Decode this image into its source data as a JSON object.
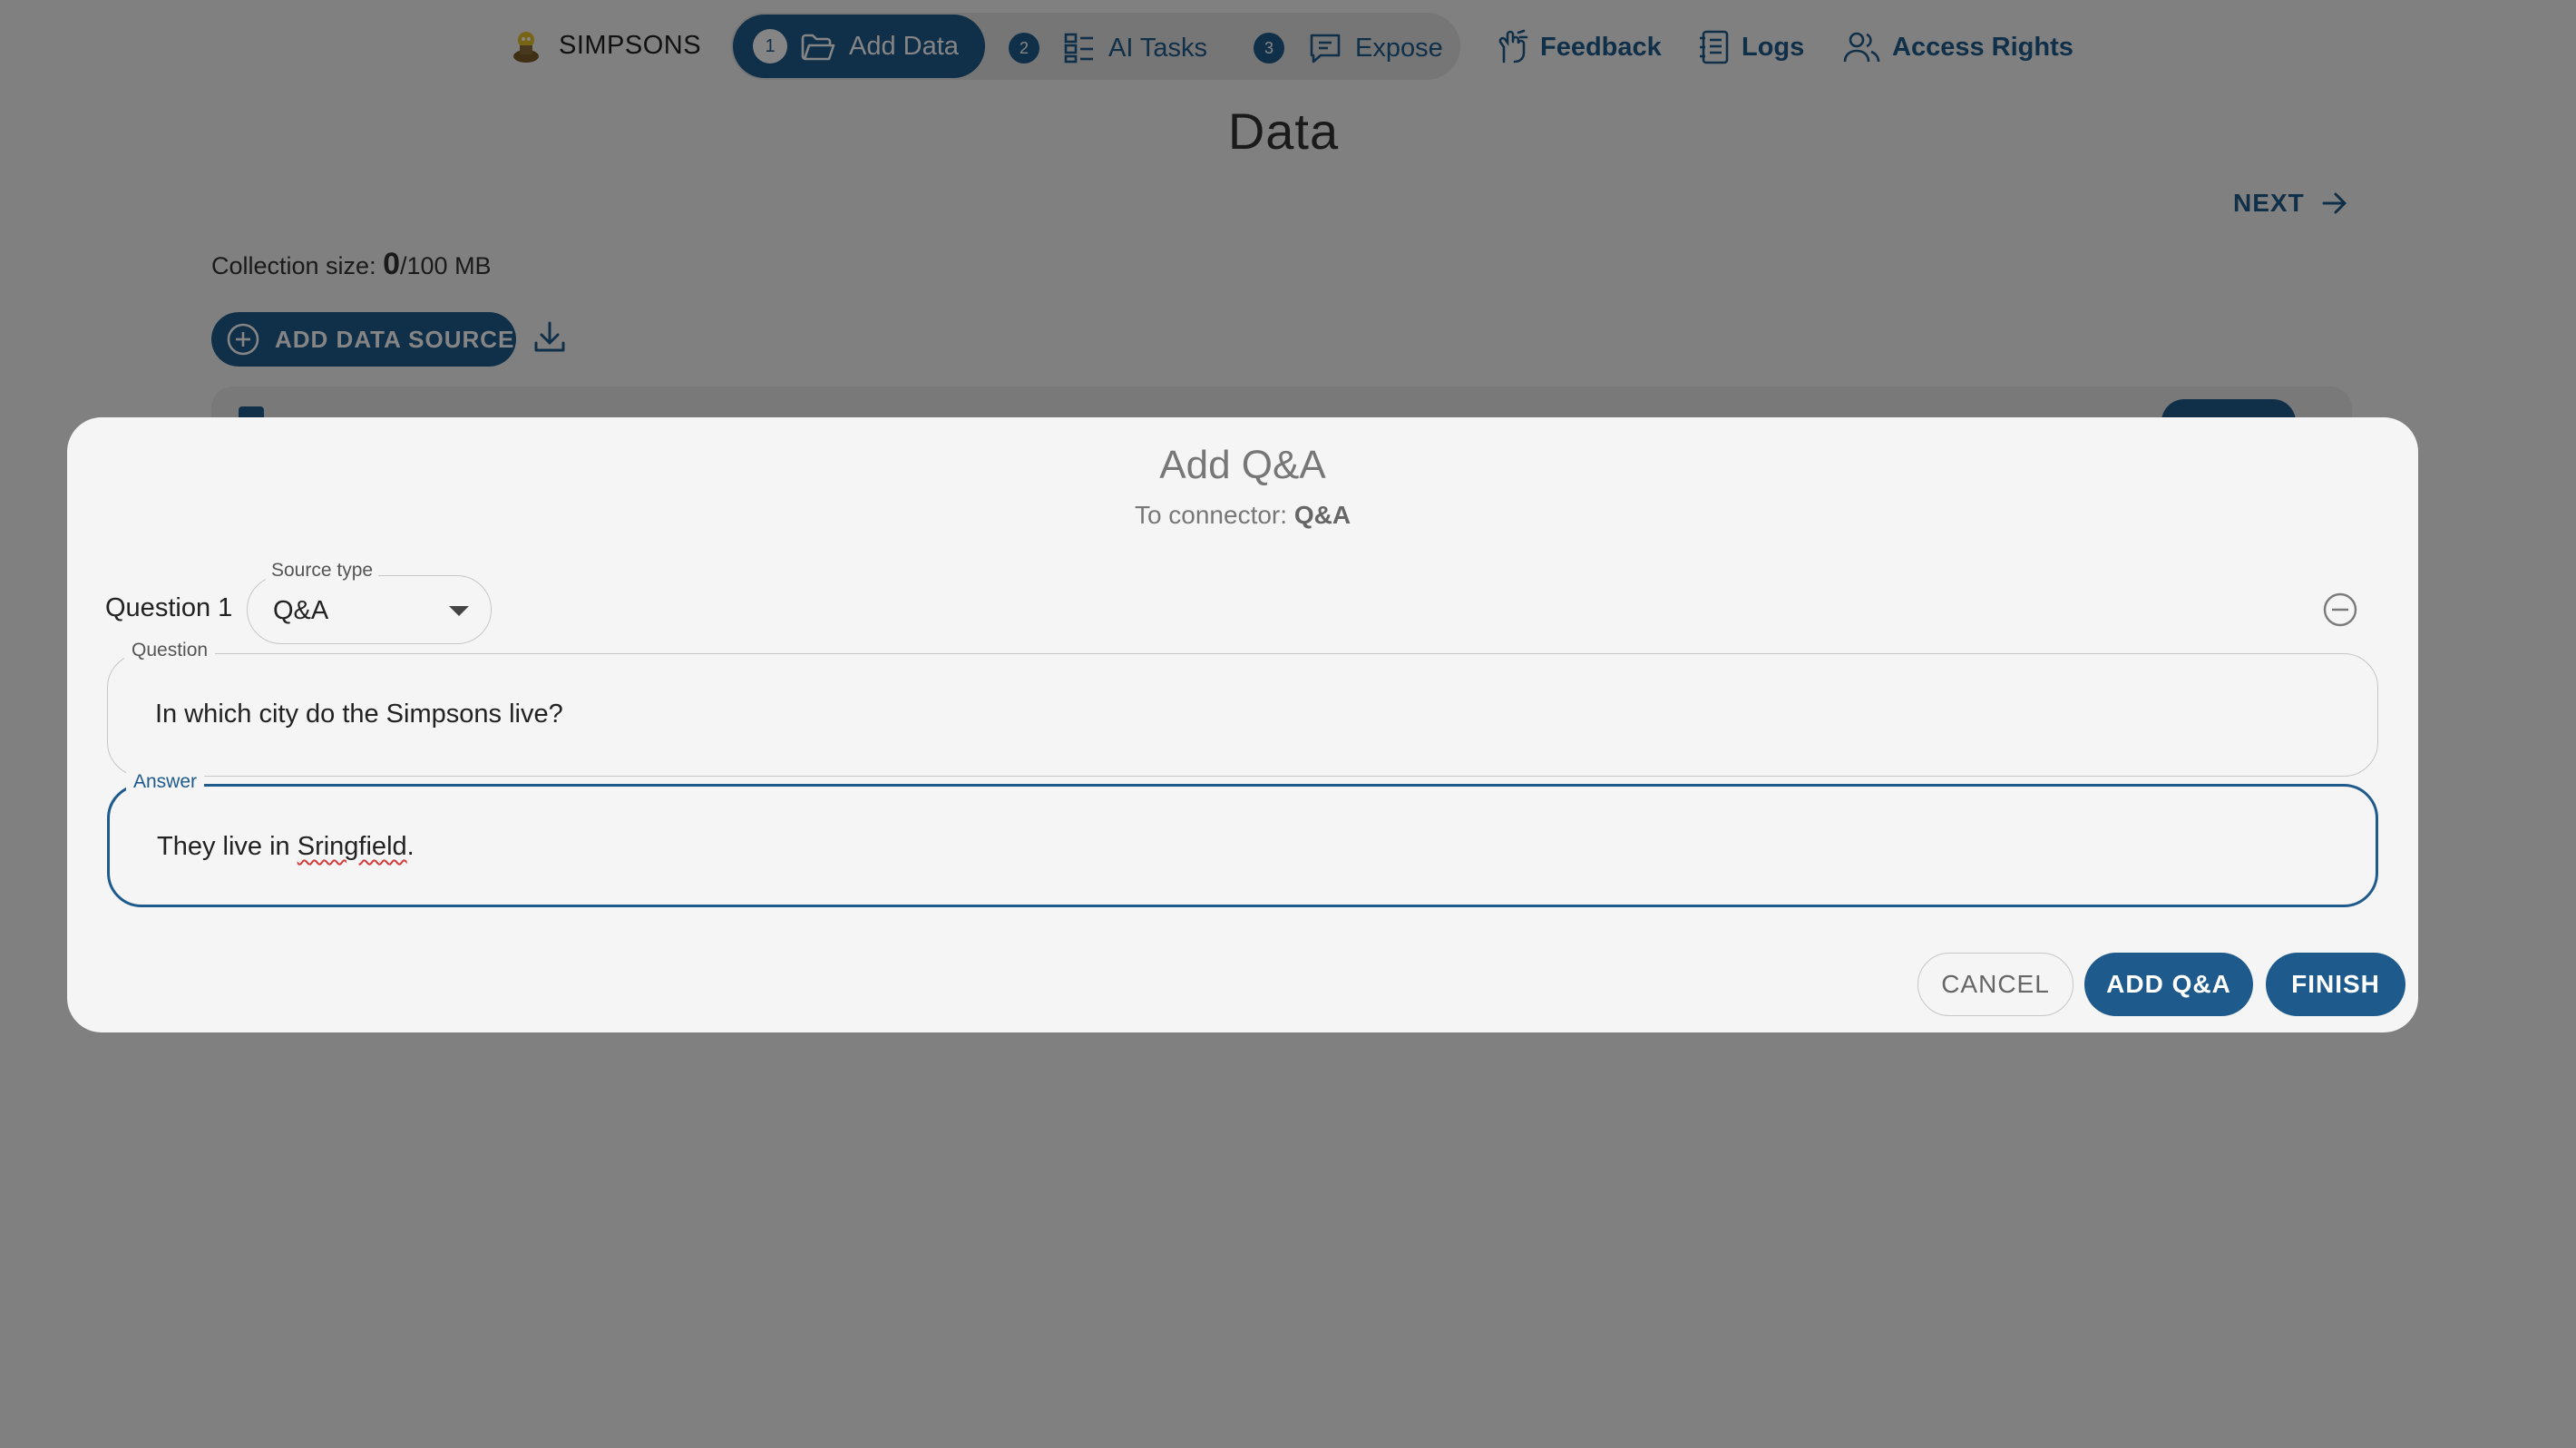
{
  "app": {
    "brand": "SIMPSONS",
    "steps": [
      {
        "num": "1",
        "label": "Add Data",
        "icon": "folder-open-icon",
        "active": true
      },
      {
        "num": "2",
        "label": "AI Tasks",
        "icon": "grid-list-icon",
        "active": false
      },
      {
        "num": "3",
        "label": "Expose",
        "icon": "message-square-icon",
        "active": false
      }
    ],
    "nav": [
      {
        "label": "Feedback",
        "icon": "feedback-hand-icon"
      },
      {
        "label": "Logs",
        "icon": "logs-notebook-icon"
      },
      {
        "label": "Access Rights",
        "icon": "users-icon"
      }
    ]
  },
  "page": {
    "title": "Data",
    "next_label": "NEXT",
    "collection_label": "Collection size:",
    "collection_used": "0",
    "collection_total": "/100 MB",
    "add_source_label": "ADD DATA SOURCE"
  },
  "modal": {
    "title": "Add Q&A",
    "subtitle_prefix": "To connector:",
    "subtitle_connector": "Q&A",
    "question_label": "Question 1",
    "source_type_legend": "Source type",
    "source_type_value": "Q&A",
    "question_legend": "Question",
    "question_value": "In which city do the Simpsons live?",
    "answer_legend": "Answer",
    "answer_prefix": "They live in ",
    "answer_misspelled": "Sringfield",
    "answer_suffix": ".",
    "cancel_label": "CANCEL",
    "add_label": "ADD Q&A",
    "finish_label": "FINISH"
  },
  "colors": {
    "primary": "#1f5a8c",
    "overlay": "rgba(0,0,0,0.48)",
    "modal_bg": "#f5f5f5",
    "spellcheck": "#d23b3b"
  }
}
